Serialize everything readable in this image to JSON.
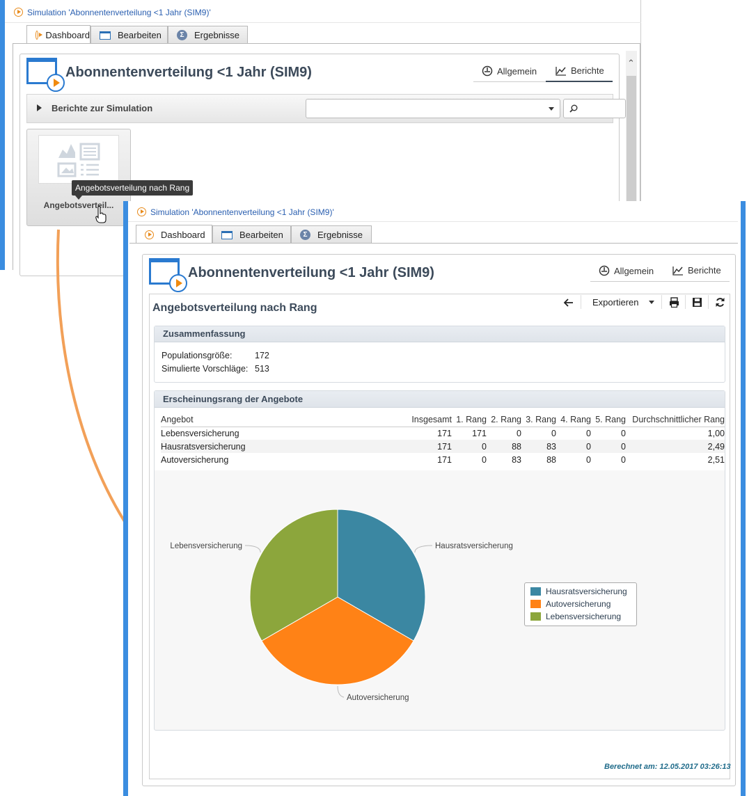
{
  "sim_link": "Simulation 'Abonnentenverteilung <1 Jahr  (SIM9)'",
  "tabs": [
    {
      "label": "Dashboard",
      "icon": "play-icon"
    },
    {
      "label": "Bearbeiten",
      "icon": "window-icon"
    },
    {
      "label": "Ergebnisse",
      "icon": "sigma-icon"
    }
  ],
  "title": "Abonnentenverteilung <1 Jahr (SIM9)",
  "view_tabs": {
    "general": "Allgemein",
    "reports": "Berichte"
  },
  "back_window": {
    "reports_bar_label": "Berichte zur Simulation",
    "select_value": "",
    "search_placeholder": "",
    "report_tile_label": "Angebotsverteil...",
    "tooltip": "Angebotsverteilung nach Rang"
  },
  "report": {
    "title": "Angebotsverteilung nach Rang",
    "export_label": "Exportieren",
    "summary": {
      "heading": "Zusammenfassung",
      "rows": [
        {
          "label": "Populationsgröße:",
          "value": "172"
        },
        {
          "label": "Simulierte Vorschläge:",
          "value": "513"
        }
      ]
    },
    "rank_section": {
      "heading": "Erscheinungsrang der Angebote",
      "columns": [
        "Angebot",
        "Insgesamt",
        "1. Rang",
        "2. Rang",
        "3. Rang",
        "4. Rang",
        "5. Rang",
        "Durchschnittlicher Rang"
      ],
      "rows": [
        [
          "Lebensversicherung",
          "171",
          "171",
          "0",
          "0",
          "0",
          "0",
          "1,00"
        ],
        [
          "Hausratsversicherung",
          "171",
          "0",
          "88",
          "83",
          "0",
          "0",
          "2,49"
        ],
        [
          "Autoversicherung",
          "171",
          "0",
          "83",
          "88",
          "0",
          "0",
          "2,51"
        ]
      ]
    },
    "footer": "Berechnet am: 12.05.2017 03:26:13"
  },
  "chart_data": {
    "type": "pie",
    "categories": [
      "Hausratsversicherung",
      "Autoversicherung",
      "Lebensversicherung"
    ],
    "values": [
      171,
      171,
      171
    ],
    "colors": [
      "#3b87a2",
      "#ff8216",
      "#8ca63c"
    ],
    "legend_placement": "right"
  },
  "colors": {
    "accent": "#2a7ad0",
    "link": "#2a5fb0",
    "arrow": "#f2a058",
    "footer": "#1f6b8a"
  }
}
